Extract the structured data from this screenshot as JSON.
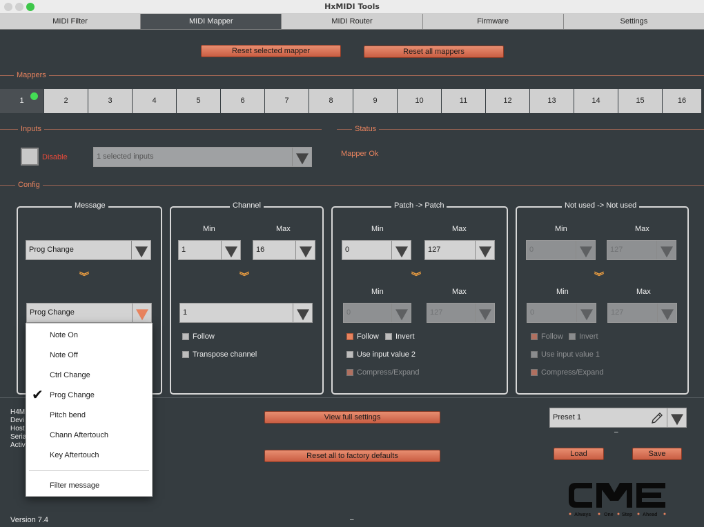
{
  "window": {
    "title": "HxMIDI Tools"
  },
  "tabs": [
    {
      "label": "MIDI Filter"
    },
    {
      "label": "MIDI Mapper"
    },
    {
      "label": "MIDI Router"
    },
    {
      "label": "Firmware"
    },
    {
      "label": "Settings"
    }
  ],
  "actions": {
    "reset_selected": "Reset selected mapper",
    "reset_all": "Reset all mappers"
  },
  "sections": {
    "mappers": "Mappers",
    "inputs": "Inputs",
    "status": "Status",
    "config": "Config"
  },
  "mappers": [
    "1",
    "2",
    "3",
    "4",
    "5",
    "6",
    "7",
    "8",
    "9",
    "10",
    "11",
    "12",
    "13",
    "14",
    "15",
    "16"
  ],
  "inputs": {
    "disable_label": "Disable",
    "selected_inputs": "1 selected inputs"
  },
  "status": {
    "text": "Mapper Ok"
  },
  "message_box": {
    "title": "Message",
    "input_value": "Prog Change",
    "output_value": "Prog Change"
  },
  "channel_box": {
    "title": "Channel",
    "min_label": "Min",
    "max_label": "Max",
    "min_value": "1",
    "max_value": "16",
    "output_value": "1",
    "follow_label": "Follow",
    "transpose_label": "Transpose channel"
  },
  "patch_box": {
    "title": "Patch -> Patch",
    "min_label": "Min",
    "max_label": "Max",
    "min_value": "0",
    "max_value": "127",
    "out_min_label": "Min",
    "out_max_label": "Max",
    "out_min_value": "0",
    "out_max_value": "127",
    "follow_label": "Follow",
    "invert_label": "Invert",
    "use_input_label": "Use input value 2",
    "compress_label": "Compress/Expand"
  },
  "notused_box": {
    "title": "Not used -> Not used",
    "min_label": "Min",
    "max_label": "Max",
    "min_value": "0",
    "max_value": "127",
    "out_min_label": "Min",
    "out_max_label": "Max",
    "out_min_value": "0",
    "out_max_value": "127",
    "follow_label": "Follow",
    "invert_label": "Invert",
    "use_input_label": "Use input value 1",
    "compress_label": "Compress/Expand"
  },
  "menu": {
    "items": [
      "Note On",
      "Note Off",
      "Ctrl Change",
      "Prog Change",
      "Pitch bend",
      "Chann Aftertouch",
      "Key Aftertouch"
    ],
    "checked": "Prog Change",
    "filter": "Filter message"
  },
  "device_info_partial": [
    "H4M",
    "Devi",
    "Host",
    "Seria",
    "Activ"
  ],
  "bottom": {
    "view_full": "View full settings",
    "reset_factory": "Reset all to factory defaults",
    "preset": "Preset 1",
    "preset_sub": "–",
    "load": "Load",
    "save": "Save",
    "version": "Version 7.4",
    "center_dash": "–"
  },
  "logo": {
    "text": "CME",
    "tagline": "Always One Step Ahead"
  },
  "colors": {
    "accent": "#e8835e",
    "led": "#44dd55",
    "background": "#353c40"
  }
}
